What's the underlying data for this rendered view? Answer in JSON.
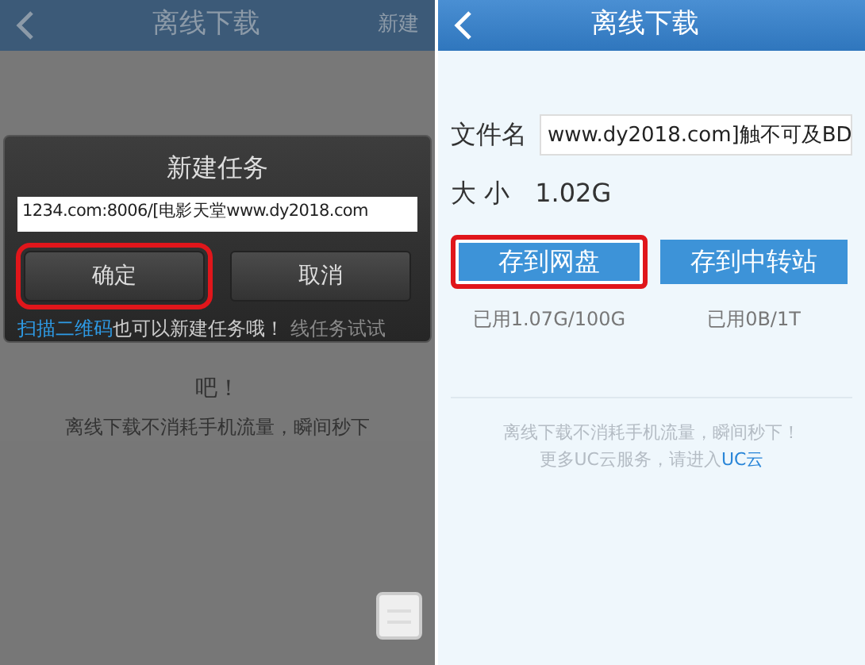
{
  "left_screen": {
    "header": {
      "title": "离线下载",
      "action": "新建"
    },
    "background_text": {
      "covered_line_end": "线任务试试",
      "line_end": "吧！",
      "hint": "离线下载不消耗手机流量，瞬间秒下"
    },
    "dialog": {
      "title": "新建任务",
      "url_value": "1234.com:8006/[电影天堂www.dy2018.com",
      "buttons": [
        {
          "label": "确定",
          "highlighted": true
        },
        {
          "label": "取消",
          "highlighted": false
        }
      ],
      "note_link": "扫描二维码",
      "note_text": "也可以新建任务哦！"
    }
  },
  "right_screen": {
    "header": {
      "title": "离线下载"
    },
    "filename_label": "文件名",
    "filename_value": "www.dy2018.com]触不可及BD",
    "size_label": "大  小",
    "size_value": "1.02G",
    "targets": [
      {
        "label": "存到网盘",
        "highlighted": true,
        "usage": "已用1.07G/100G"
      },
      {
        "label": "存到中转站",
        "highlighted": false,
        "usage": "已用0B/1T"
      }
    ],
    "footer_line": "离线下载不消耗手机流量，瞬间秒下！",
    "footer_text": "更多UC云服务，请进入",
    "footer_link": "UC云"
  }
}
